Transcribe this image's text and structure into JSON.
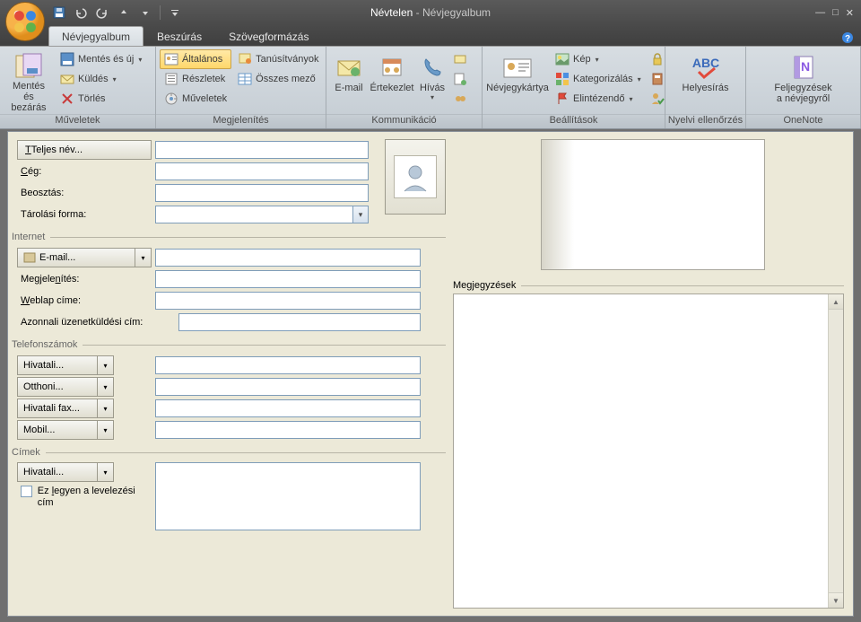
{
  "title": {
    "doc": "Névtelen",
    "sep": " - ",
    "app": "Névjegyalbum"
  },
  "tabs": {
    "t0": "Névjegyalbum",
    "t1": "Beszúrás",
    "t2": "Szövegformázás"
  },
  "qat": {
    "save": "save",
    "undo": "undo",
    "redo": "redo",
    "up": "up",
    "down": "down"
  },
  "ribbon": {
    "muveletek": {
      "label": "Műveletek",
      "save_close": "Mentés és bezárás",
      "save_new": "Mentés és új",
      "send": "Küldés",
      "delete": "Törlés"
    },
    "megjelenites": {
      "label": "Megjelenítés",
      "general": "Általános",
      "details": "Részletek",
      "activities": "Műveletek",
      "certs": "Tanúsítványok",
      "allfields": "Összes mező"
    },
    "kommunikacio": {
      "label": "Kommunikáció",
      "email": "E-mail",
      "meeting": "Értekezlet",
      "call": "Hívás"
    },
    "beallitasok": {
      "label": "Beállítások",
      "bizcard": "Névjegykártya",
      "picture": "Kép",
      "categorize": "Kategorizálás",
      "followup": "Elintézendő"
    },
    "nyelvi": {
      "label": "Nyelvi ellenőrzés",
      "spell": "Helyesírás"
    },
    "onenote": {
      "label": "OneNote",
      "btn": "Feljegyzések a névjegyről"
    }
  },
  "form": {
    "fullname_btn": "Teljes név...",
    "company": "Cég:",
    "jobtitle": "Beosztás:",
    "fileas": "Tárolási forma:",
    "internet_hdr": "Internet",
    "email_btn": "E-mail...",
    "display": "Megjelenítés:",
    "webpage": "Weblap címe:",
    "im": "Azonnali üzenetküldési cím:",
    "phones_hdr": "Telefonszámok",
    "ph_business": "Hivatali...",
    "ph_home": "Otthoni...",
    "ph_bfax": "Hivatali fax...",
    "ph_mobile": "Mobil...",
    "addr_hdr": "Címek",
    "addr_business": "Hivatali...",
    "mailing_chk": "Ez legyen a levelezési cím",
    "notes_hdr": "Megjegyzések"
  }
}
